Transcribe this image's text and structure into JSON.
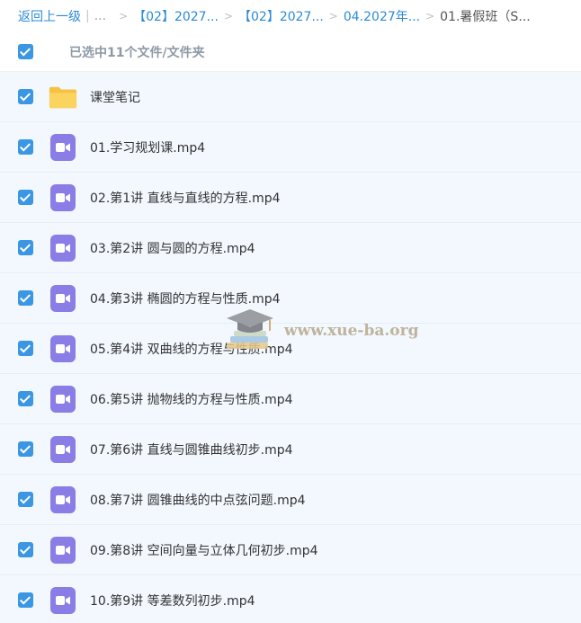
{
  "breadcrumb": {
    "back_label": "返回上一级",
    "bar": "|",
    "dots": "...",
    "arrow": ">",
    "crumbs": [
      "【02】2027...",
      "【02】2027...",
      "04.2027年..."
    ],
    "current": "01.暑假班（S..."
  },
  "selection": {
    "label": "已选中11个文件/文件夹"
  },
  "files": [
    {
      "name": "课堂笔记",
      "type": "folder"
    },
    {
      "name": "01.学习规划课.mp4",
      "type": "video"
    },
    {
      "name": "02.第1讲 直线与直线的方程.mp4",
      "type": "video"
    },
    {
      "name": "03.第2讲 圆与圆的方程.mp4",
      "type": "video"
    },
    {
      "name": "04.第3讲 椭圆的方程与性质.mp4",
      "type": "video"
    },
    {
      "name": "05.第4讲 双曲线的方程与性质.mp4",
      "type": "video"
    },
    {
      "name": "06.第5讲 抛物线的方程与性质.mp4",
      "type": "video"
    },
    {
      "name": "07.第6讲 直线与圆锥曲线初步.mp4",
      "type": "video"
    },
    {
      "name": "08.第7讲 圆锥曲线的中点弦问题.mp4",
      "type": "video"
    },
    {
      "name": "09.第8讲 空间向量与立体几何初步.mp4",
      "type": "video"
    },
    {
      "name": "10.第9讲 等差数列初步.mp4",
      "type": "video"
    }
  ],
  "watermark": {
    "text": "www.xue-ba.org",
    "icon": "graduation-cap-books-icon"
  },
  "colors": {
    "link": "#2b8ad6",
    "checkbox": "#3b97e3",
    "row_bg": "#f2f8fe",
    "video_icon": "#8a7de6",
    "folder": "#f8cd54"
  }
}
